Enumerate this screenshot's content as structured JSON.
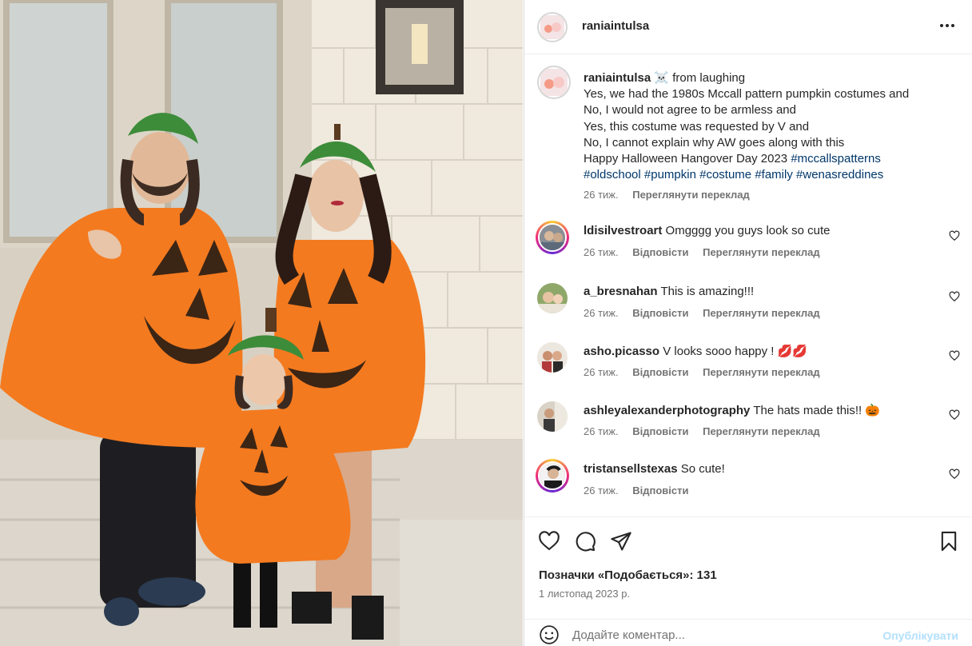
{
  "post": {
    "username": "raniaintulsa",
    "caption_username": "raniaintulsa",
    "caption_lines": [
      "☠️ from laughing",
      "Yes, we had the 1980s Mccall pattern pumpkin costumes and",
      "No, I would not agree to be armless and",
      "Yes, this costume was requested by V and",
      "No, I cannot explain why AW goes along with this",
      "Happy Halloween Hangover Day 2023 "
    ],
    "tags_line1": "#mccallspatterns",
    "tags_line2": [
      "#oldschool",
      "#pumpkin",
      "#costume",
      "#family",
      "#wenasreddines"
    ],
    "caption_time": "26 тиж.",
    "caption_translate": "Переглянути переклад"
  },
  "comments": [
    {
      "username": "ldisilvestroart",
      "text": "Omgggg you guys look so cute",
      "time": "26 тиж.",
      "reply": "Відповісти",
      "translate": "Переглянути переклад",
      "story": true
    },
    {
      "username": "a_bresnahan",
      "text": "This is amazing!!!",
      "time": "26 тиж.",
      "reply": "Відповісти",
      "translate": "Переглянути переклад",
      "story": false
    },
    {
      "username": "asho.picasso",
      "text": "V looks sooo happy ! 💋💋",
      "time": "26 тиж.",
      "reply": "Відповісти",
      "translate": "Переглянути переклад",
      "story": false
    },
    {
      "username": "ashleyalexanderphotography",
      "text": "The hats made this!! 🎃",
      "time": "26 тиж.",
      "reply": "Відповісти",
      "translate": "Переглянути переклад",
      "story": false
    },
    {
      "username": "tristansellstexas",
      "text": "So cute!",
      "time": "26 тиж.",
      "reply": "Відповісти",
      "translate": "",
      "story": true
    }
  ],
  "actions": {
    "likes": "Позначки «Подобається»: 131",
    "date": "1 листопад 2023 р."
  },
  "comment_box": {
    "placeholder": "Додайте коментар...",
    "post_label": "Опублікувати"
  },
  "icons": {
    "more": "more-options-icon",
    "like": "heart-icon",
    "comment": "comment-icon",
    "share": "share-icon",
    "save": "bookmark-icon",
    "emoji": "emoji-icon"
  }
}
